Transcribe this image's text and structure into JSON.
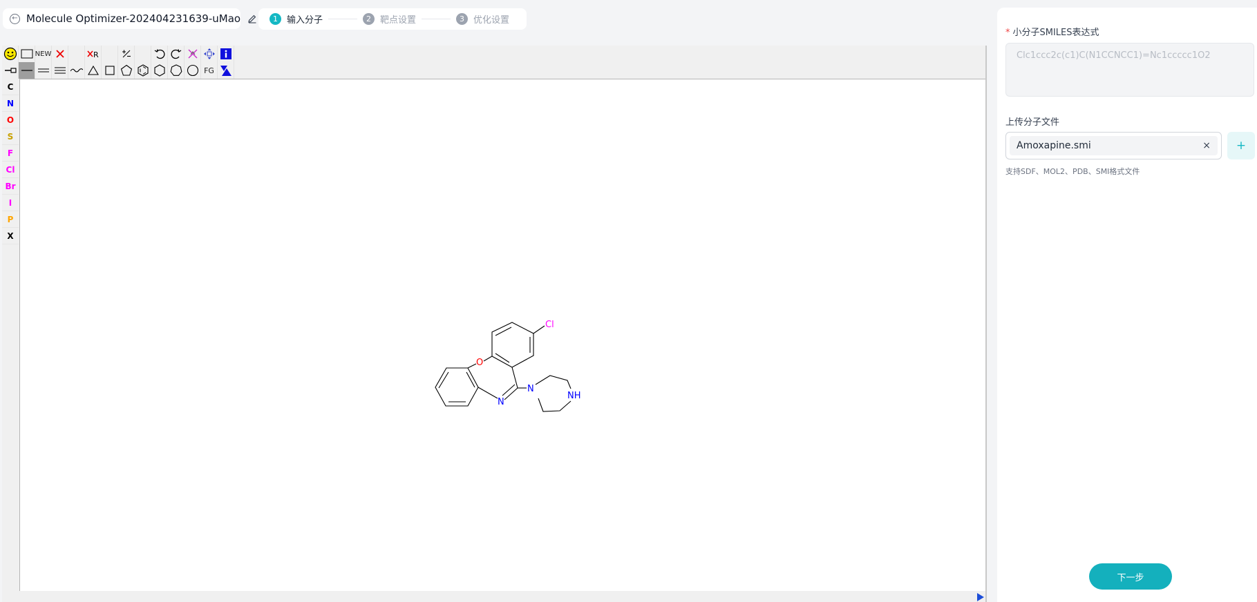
{
  "header": {
    "project_title": "Molecule Optimizer-202404231639-uMao",
    "back_icon": "back-icon",
    "edit_icon": "pencil-icon"
  },
  "steps": [
    {
      "num": "1",
      "label": "输入分子",
      "state": "active"
    },
    {
      "num": "2",
      "label": "靶点设置",
      "state": "inactive"
    },
    {
      "num": "3",
      "label": "优化设置",
      "state": "inactive"
    }
  ],
  "editor": {
    "toolbar_row1": [
      "smiley-icon",
      "select-rect-icon",
      "NEW",
      "delete-x-icon",
      "blank",
      "clear-r-icon",
      "blank",
      "charge-icon",
      "blank",
      "undo-icon",
      "redo-icon",
      "erase-icon",
      "move-icon",
      "info-icon"
    ],
    "toolbar_row2": [
      "chain-icon",
      "single-bond",
      "double-bond",
      "triple-bond",
      "wavy-bond",
      "triangle-ring",
      "square-ring",
      "pentagon-ring",
      "benzene-ring",
      "hexagon-ring",
      "heptagon-ring",
      "octagon-ring",
      "FG",
      "template-icon"
    ],
    "elements": [
      {
        "symbol": "C",
        "color": "#000000"
      },
      {
        "symbol": "N",
        "color": "#0000ff"
      },
      {
        "symbol": "O",
        "color": "#ff0000"
      },
      {
        "symbol": "S",
        "color": "#c8a000"
      },
      {
        "symbol": "F",
        "color": "#ff00ff"
      },
      {
        "symbol": "Cl",
        "color": "#ff00ff"
      },
      {
        "symbol": "Br",
        "color": "#ff00ff"
      },
      {
        "symbol": "I",
        "color": "#ff00ff"
      },
      {
        "symbol": "P",
        "color": "#ffa500"
      },
      {
        "symbol": "X",
        "color": "#000000"
      }
    ],
    "molecule": {
      "atom_labels": {
        "cl": "Cl",
        "o": "O",
        "n_imine": "N",
        "n_ring": "N",
        "nh": "NH"
      },
      "colors": {
        "cl": "#ff00ff",
        "o": "#ff0000",
        "n": "#0000ff"
      }
    }
  },
  "form": {
    "smiles_label": "小分子SMILES表达式",
    "required_mark": "*",
    "smiles_value": "Clc1ccc2c(c1)C(N1CCNCC1)=Nc1ccccc1O2",
    "upload_label": "上传分子文件",
    "file_name": "Amoxapine.smi",
    "remove_symbol": "×",
    "add_symbol": "+",
    "hint": "支持SDF、MOL2、PDB、SMI格式文件",
    "next_button": "下一步"
  },
  "colors": {
    "accent": "#14b8c4",
    "required": "#ef4444"
  }
}
